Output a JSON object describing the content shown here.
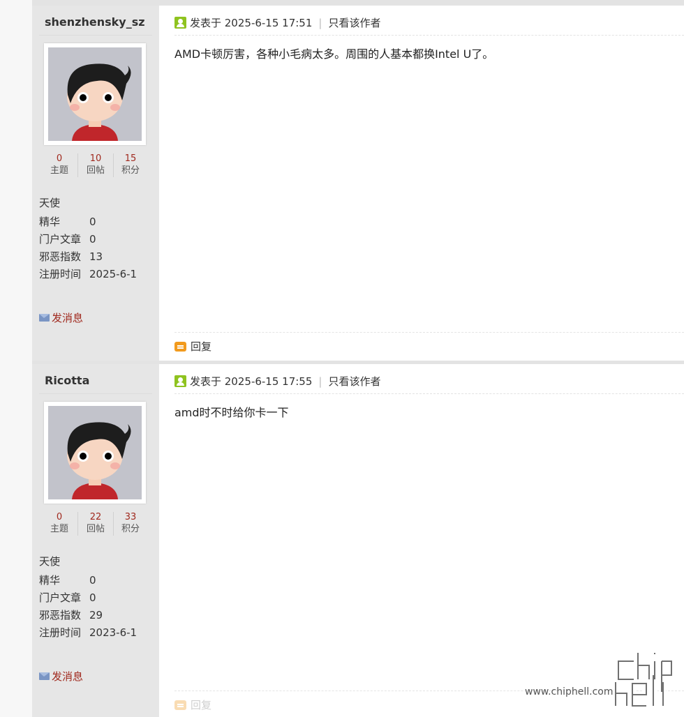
{
  "posts": [
    {
      "username": "shenzhensky_sz",
      "stats": [
        {
          "value": "0",
          "label": "主题"
        },
        {
          "value": "10",
          "label": "回帖"
        },
        {
          "value": "15",
          "label": "积分"
        }
      ],
      "rank": "天使",
      "info": [
        {
          "key": "精华",
          "value": "0"
        },
        {
          "key": "门户文章",
          "value": "0"
        },
        {
          "key": "邪恶指数",
          "value": "13"
        },
        {
          "key": "注册时间",
          "value": "2025-6-1"
        }
      ],
      "message_link": "发消息",
      "posted_at": "发表于 2025-6-15 17:51",
      "only_author": "只看该作者",
      "content": "AMD卡顿厉害，各种小毛病太多。周围的人基本都换Intel U了。",
      "reply_label": "回复"
    },
    {
      "username": "Ricotta",
      "stats": [
        {
          "value": "0",
          "label": "主题"
        },
        {
          "value": "22",
          "label": "回帖"
        },
        {
          "value": "33",
          "label": "积分"
        }
      ],
      "rank": "天使",
      "info": [
        {
          "key": "精华",
          "value": "0"
        },
        {
          "key": "门户文章",
          "value": "0"
        },
        {
          "key": "邪恶指数",
          "value": "29"
        },
        {
          "key": "注册时间",
          "value": "2023-6-1"
        }
      ],
      "message_link": "发消息",
      "posted_at": "发表于 2025-6-15 17:55",
      "only_author": "只看该作者",
      "content": "amd时不时给你卡一下",
      "reply_label": "回复"
    }
  ],
  "watermark": {
    "logo_text": "chip hell",
    "url": "www.chiphell.com"
  },
  "icons": {
    "post_time": "user-icon",
    "message": "mail-icon",
    "reply": "reply-icon"
  },
  "colors": {
    "accent_red": "#a0291e",
    "sidebar_bg": "#e6e6e6",
    "reply_icon": "#f29a1d",
    "user_icon": "#8fc31f"
  }
}
